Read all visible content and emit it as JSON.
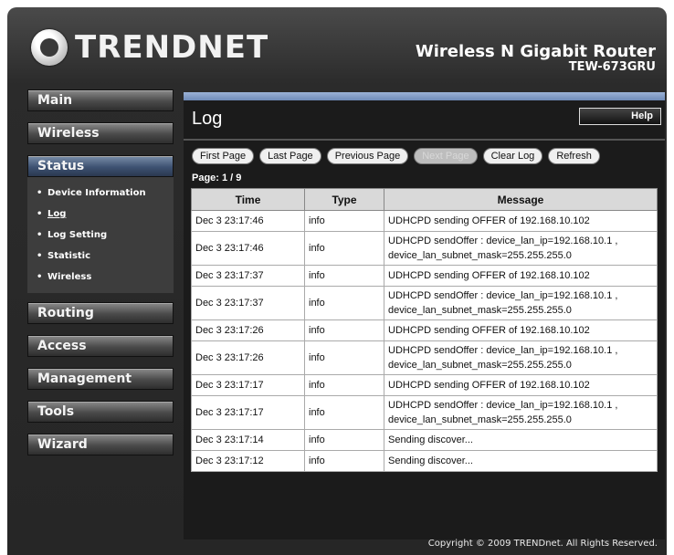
{
  "brand": {
    "logo_text": "TRENDNET"
  },
  "product": {
    "name": "Wireless N Gigabit Router",
    "model": "TEW-673GRU"
  },
  "nav": {
    "main": "Main",
    "wireless": "Wireless",
    "status": "Status",
    "status_items": [
      "Device Information",
      "Log",
      "Log Setting",
      "Statistic",
      "Wireless"
    ],
    "routing": "Routing",
    "access": "Access",
    "management": "Management",
    "tools": "Tools",
    "wizard": "Wizard"
  },
  "page": {
    "title": "Log",
    "help": "Help"
  },
  "pager": {
    "first": "First Page",
    "last": "Last Page",
    "previous": "Previous Page",
    "next": "Next Page",
    "clear": "Clear Log",
    "refresh": "Refresh",
    "page_info": "Page: 1 / 9"
  },
  "table": {
    "headers": [
      "Time",
      "Type",
      "Message"
    ],
    "rows": [
      {
        "time": "Dec 3 23:17:46",
        "type": "info",
        "msg1": "UDHCPD sending OFFER of 192.168.10.102"
      },
      {
        "time": "Dec 3 23:17:46",
        "type": "info",
        "msg1": "UDHCPD sendOffer : device_lan_ip=192.168.10.1 ,",
        "msg2": "device_lan_subnet_mask=255.255.255.0"
      },
      {
        "time": "Dec 3 23:17:37",
        "type": "info",
        "msg1": "UDHCPD sending OFFER of 192.168.10.102"
      },
      {
        "time": "Dec 3 23:17:37",
        "type": "info",
        "msg1": "UDHCPD sendOffer : device_lan_ip=192.168.10.1 ,",
        "msg2": "device_lan_subnet_mask=255.255.255.0"
      },
      {
        "time": "Dec 3 23:17:26",
        "type": "info",
        "msg1": "UDHCPD sending OFFER of 192.168.10.102"
      },
      {
        "time": "Dec 3 23:17:26",
        "type": "info",
        "msg1": "UDHCPD sendOffer : device_lan_ip=192.168.10.1 ,",
        "msg2": "device_lan_subnet_mask=255.255.255.0"
      },
      {
        "time": "Dec 3 23:17:17",
        "type": "info",
        "msg1": "UDHCPD sending OFFER of 192.168.10.102"
      },
      {
        "time": "Dec 3 23:17:17",
        "type": "info",
        "msg1": "UDHCPD sendOffer : device_lan_ip=192.168.10.1 ,",
        "msg2": "device_lan_subnet_mask=255.255.255.0"
      },
      {
        "time": "Dec 3 23:17:14",
        "type": "info",
        "msg1": "Sending discover..."
      },
      {
        "time": "Dec 3 23:17:12",
        "type": "info",
        "msg1": "Sending discover..."
      }
    ]
  },
  "footer": {
    "copyright": "Copyright © 2009 TRENDnet. All Rights Reserved."
  },
  "colors": {
    "accent_blue": "#6f8bb8",
    "background": "#262626"
  }
}
